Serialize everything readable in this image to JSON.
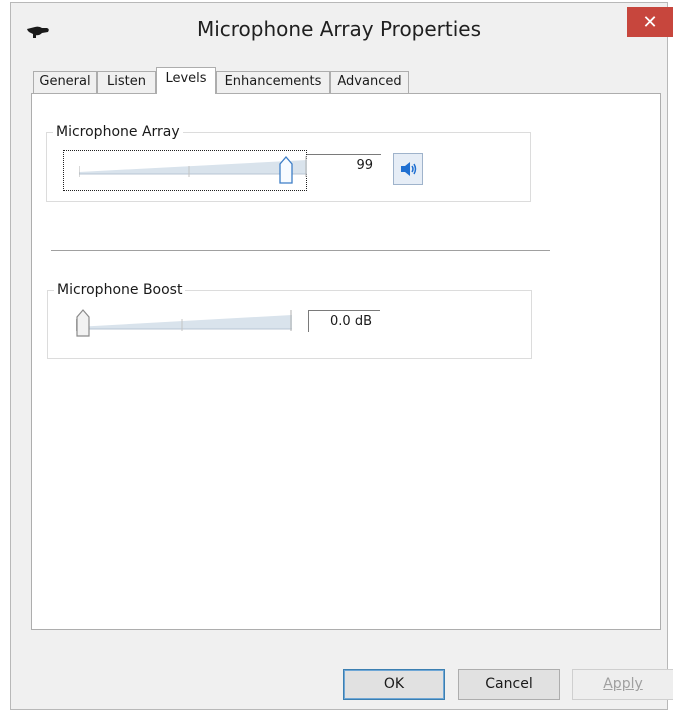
{
  "window": {
    "title": "Microphone Array Properties",
    "close_label": "✕"
  },
  "tabs": [
    {
      "label": "General",
      "active": false
    },
    {
      "label": "Listen",
      "active": false
    },
    {
      "label": "Levels",
      "active": true
    },
    {
      "label": "Enhancements",
      "active": false
    },
    {
      "label": "Advanced",
      "active": false
    }
  ],
  "levels": {
    "microphone_array": {
      "label": "Microphone Array",
      "value_text": "99",
      "level": 0.99,
      "muted": false
    },
    "microphone_boost": {
      "label": "Microphone Boost",
      "value_text": "0.0 dB",
      "level": 0.0
    }
  },
  "buttons": {
    "ok": "OK",
    "cancel": "Cancel",
    "apply": "Apply",
    "apply_enabled": false
  },
  "colors": {
    "close_bg": "#c7463d",
    "accent_blue": "#1f6fd1",
    "slider_track": "#d9e3ec"
  },
  "icons": {
    "app": "microphone-icon",
    "speaker": "speaker-volume-icon",
    "close": "close-icon"
  }
}
